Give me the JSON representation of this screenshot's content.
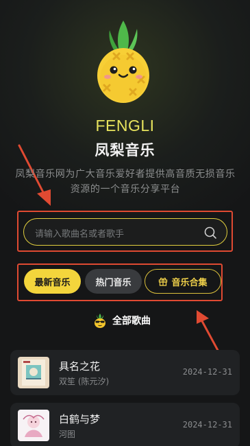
{
  "brand": "FENGLI",
  "title": "凤梨音乐",
  "description": "凤梨音乐网为广大音乐爱好者提供高音质无损音乐资源的一个音乐分享平台",
  "search": {
    "placeholder": "请输入歌曲名或者歌手",
    "icon": "search-icon"
  },
  "tabs": [
    {
      "label": "最新音乐",
      "state": "active"
    },
    {
      "label": "热门音乐",
      "state": "default"
    },
    {
      "label": "音乐合集",
      "icon": "gift-icon",
      "state": "outlined"
    }
  ],
  "section": {
    "label": "全部歌曲",
    "icon": "pineapple-sunglasses-icon"
  },
  "songs": [
    {
      "name": "具名之花",
      "artist": "双笙 (陈元汐)",
      "date": "2024-12-31"
    },
    {
      "name": "白鹤与梦",
      "artist": "河图",
      "date": "2024-12-31"
    }
  ],
  "colors": {
    "accent": "#f3d53c",
    "brand_text": "#e7e35d",
    "annotation": "#e04a32",
    "card_bg": "#202224"
  }
}
